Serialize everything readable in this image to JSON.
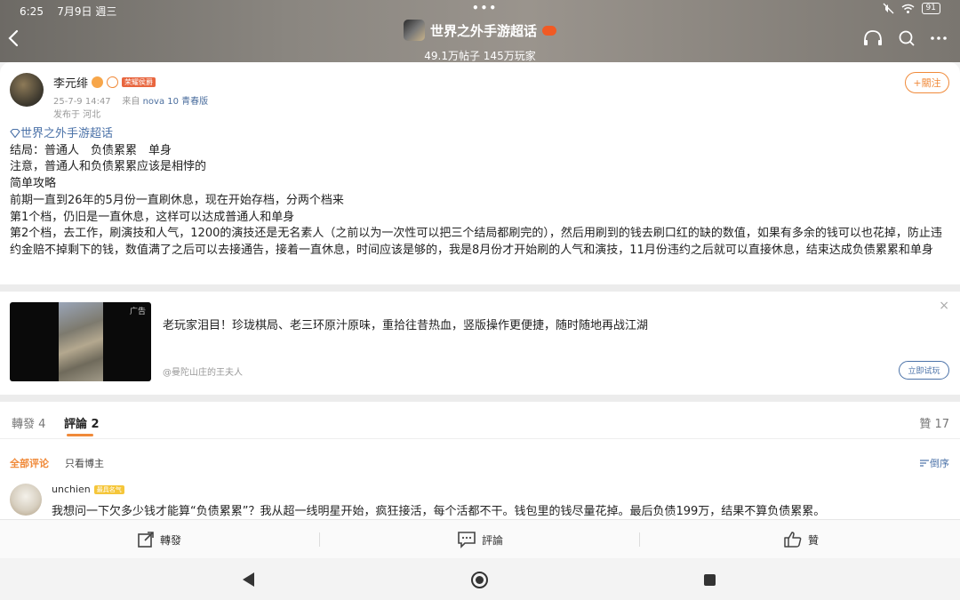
{
  "status": {
    "time": "6:25",
    "date": "7月9日 週三",
    "dots": "•••",
    "battery": "91"
  },
  "header": {
    "topic_title": "世界之外手游超话",
    "stats": "49.1万帖子 145万玩家",
    "icons": [
      "chevron-left-icon",
      "listen-icon",
      "search-icon",
      "more-icon"
    ]
  },
  "post": {
    "username": "李元绯",
    "user_tag": "荣耀侯爵",
    "time": "25-7-9 14:47",
    "from_label": "来自",
    "device": "nova 10 青春版",
    "location": "发布于 河北",
    "follow_label": "+關注",
    "topic_link": "世界之外手游超话",
    "lines": [
      "结局：普通人　负债累累　单身",
      "注意，普通人和负债累累应该是相悖的",
      "简单攻略",
      "前期一直到26年的5月份一直刷休息，现在开始存档，分两个档来",
      "第1个档，仍旧是一直休息，这样可以达成普通人和单身",
      "第2个档，去工作，刷演技和人气，1200的演技还是无名素人（之前以为一次性可以把三个结局都刷完的），然后用刷到的钱去刷口红的缺的数值，如果有多余的钱可以也花掉，防止违约金赔不掉剩下的钱，数值满了之后可以去接通告，接着一直休息，时间应该是够的，我是8月份才开始刷的人气和演技，11月份违约之后就可以直接休息，结束达成负债累累和单身"
    ]
  },
  "ad": {
    "label": "广告",
    "title": "老玩家泪目！珍珑棋局、老三环原汁原味，重拾往昔热血，竖版操作更便捷，随时随地再战江湖",
    "source": "@曼陀山庄的王夫人",
    "cta": "立即试玩",
    "close": "×"
  },
  "tabs": {
    "repost": "轉發 4",
    "comments": "評論 2",
    "likes": "贊 17"
  },
  "filters": {
    "all": "全部评论",
    "author_only": "只看博主",
    "sort": "倒序"
  },
  "comment": {
    "username": "unchien",
    "badge": "最具名气",
    "text": "我想问一下欠多少钱才能算“负债累累”？我从超一线明星开始，疯狂接活，每个活都不干。钱包里的钱尽量花掉。最后负债199万，结果不算负债累累。"
  },
  "bottom_actions": {
    "repost": "轉發",
    "comment": "評論",
    "like": "贊"
  },
  "colors": {
    "accent": "#f08a3a",
    "link": "#4b72a8"
  }
}
